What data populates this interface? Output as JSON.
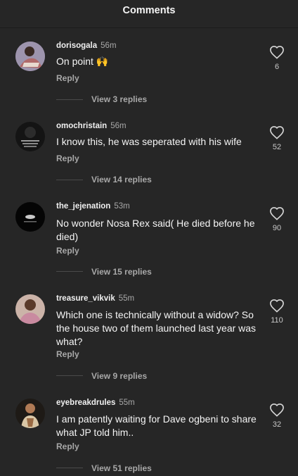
{
  "header": {
    "title": "Comments"
  },
  "comments": [
    {
      "username": "dorisogala",
      "time": "56m",
      "text": "On point 🙌",
      "reply_label": "Reply",
      "view_replies": "View 3 replies",
      "likes": "6"
    },
    {
      "username": "omochristain",
      "time": "56m",
      "text": "I know this, he was seperated with his wife",
      "reply_label": "Reply",
      "view_replies": "View 14 replies",
      "likes": "52"
    },
    {
      "username": "the_jejenation",
      "time": "53m",
      "text": "No wonder Nosa Rex said( He died before he died)",
      "reply_label": "Reply",
      "view_replies": "View 15 replies",
      "likes": "90"
    },
    {
      "username": "treasure_vikvik",
      "time": "55m",
      "text": "Which one is technically without a widow? So the house two of them launched last year was what?",
      "reply_label": "Reply",
      "view_replies": "View 9 replies",
      "likes": "110"
    },
    {
      "username": "eyebreakdrules",
      "time": "55m",
      "text": "I am patently waiting for Dave ogbeni to share what JP told him..",
      "reply_label": "Reply",
      "view_replies": "View 51 replies",
      "likes": "32"
    }
  ],
  "icons": {
    "like": "heart-outline-icon"
  },
  "colors": {
    "background": "#262626",
    "text": "#f5f5f5",
    "muted": "#a8a8a8"
  }
}
